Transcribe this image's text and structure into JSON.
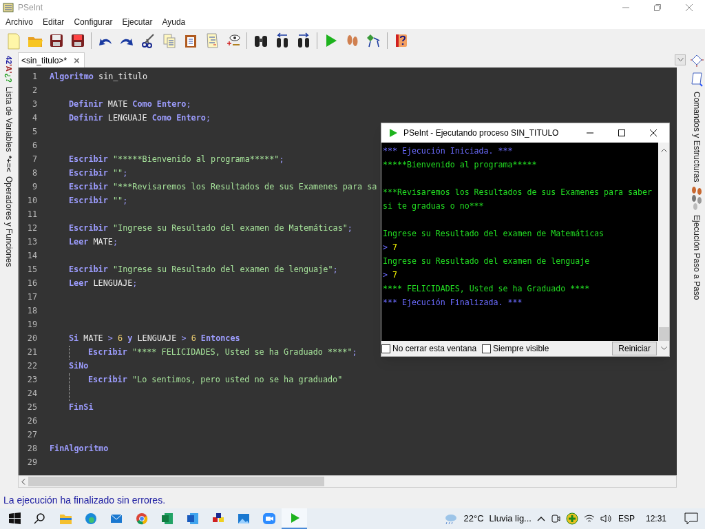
{
  "window": {
    "title": "PSeInt"
  },
  "menu": [
    "Archivo",
    "Editar",
    "Configurar",
    "Ejecutar",
    "Ayuda"
  ],
  "tabs": [
    {
      "label": "<sin_titulo>*",
      "selected": true,
      "close": "×"
    }
  ],
  "left_panel": [
    {
      "icon_texts": [
        "42",
        "'A'",
        "¿?"
      ],
      "label": "Lista de Variables"
    },
    {
      "icon_texts": [
        "*+=<"
      ],
      "label": "Operadores y Funciones"
    }
  ],
  "right_panel": [
    "Comandos y Estructuras",
    "Ejecución Paso a Paso"
  ],
  "code": [
    {
      "n": "1",
      "tokens": [
        {
          "kind": "kw",
          "t": "Algoritmo "
        },
        {
          "kind": "id",
          "t": "sin_titulo"
        }
      ],
      "children": [
        {
          "n": "2"
        },
        {
          "n": "3",
          "tokens": [
            {
              "kind": "kw",
              "t": "Definir "
            },
            {
              "kind": "id",
              "t": "MATE "
            },
            {
              "kind": "kw",
              "t": "Como Entero"
            },
            {
              "kind": "p",
              "t": ";"
            }
          ]
        },
        {
          "n": "4",
          "tokens": [
            {
              "kind": "kw",
              "t": "Definir "
            },
            {
              "kind": "id",
              "t": "LENGUAJE "
            },
            {
              "kind": "kw",
              "t": "Como Entero"
            },
            {
              "kind": "p",
              "t": ";"
            }
          ]
        },
        {
          "n": "5"
        },
        {
          "n": "6"
        },
        {
          "n": "7",
          "tokens": [
            {
              "kind": "kw",
              "t": "Escribir "
            },
            {
              "kind": "str",
              "t": "\"*****Bienvenido al programa*****\""
            },
            {
              "kind": "p",
              "t": ";"
            }
          ]
        },
        {
          "n": "8",
          "tokens": [
            {
              "kind": "kw",
              "t": "Escribir "
            },
            {
              "kind": "str",
              "t": "\"\""
            },
            {
              "kind": "p",
              "t": ";"
            }
          ]
        },
        {
          "n": "9",
          "tokens": [
            {
              "kind": "kw",
              "t": "Escribir "
            },
            {
              "kind": "str",
              "t": "\"***Revisaremos los Resultados de sus Examenes para sa"
            }
          ]
        },
        {
          "n": "10",
          "tokens": [
            {
              "kind": "kw",
              "t": "Escribir "
            },
            {
              "kind": "str",
              "t": "\"\""
            },
            {
              "kind": "p",
              "t": ";"
            }
          ]
        },
        {
          "n": "11"
        },
        {
          "n": "12",
          "tokens": [
            {
              "kind": "kw",
              "t": "Escribir "
            },
            {
              "kind": "str",
              "t": "\"Ingrese su Resultado del examen de Matemáticas\""
            },
            {
              "kind": "p",
              "t": ";"
            }
          ]
        },
        {
          "n": "13",
          "tokens": [
            {
              "kind": "kw",
              "t": "Leer "
            },
            {
              "kind": "id",
              "t": "MATE"
            },
            {
              "kind": "p",
              "t": ";"
            }
          ]
        },
        {
          "n": "14"
        },
        {
          "n": "15",
          "tokens": [
            {
              "kind": "kw",
              "t": "Escribir "
            },
            {
              "kind": "str",
              "t": "\"Ingrese su Resultado del examen de lenguaje\""
            },
            {
              "kind": "p",
              "t": ";"
            }
          ]
        },
        {
          "n": "16",
          "tokens": [
            {
              "kind": "kw",
              "t": "Leer "
            },
            {
              "kind": "id",
              "t": "LENGUAJE"
            },
            {
              "kind": "p",
              "t": ";"
            }
          ]
        },
        {
          "n": "17"
        },
        {
          "n": "18"
        },
        {
          "n": "19"
        },
        {
          "n": "20",
          "tokens": [
            {
              "kind": "kw",
              "t": "Si "
            },
            {
              "kind": "id",
              "t": "MATE "
            },
            {
              "kind": "op",
              "t": "> "
            },
            {
              "kind": "num",
              "t": "6 "
            },
            {
              "kind": "kw",
              "t": "y "
            },
            {
              "kind": "id",
              "t": "LENGUAJE "
            },
            {
              "kind": "op",
              "t": "> "
            },
            {
              "kind": "num",
              "t": "6 "
            },
            {
              "kind": "kw",
              "t": "Entonces"
            }
          ],
          "children": [
            {
              "n": "21",
              "tokens": [
                {
                  "kind": "kw",
                  "t": "Escribir "
                },
                {
                  "kind": "str",
                  "t": "\"**** FELICIDADES, Usted se ha Graduado ****\""
                },
                {
                  "kind": "p",
                  "t": ";"
                }
              ]
            }
          ]
        },
        {
          "n": "22",
          "tokens": [
            {
              "kind": "kw",
              "t": "SiNo"
            }
          ],
          "children": [
            {
              "n": "23",
              "tokens": [
                {
                  "kind": "kw",
                  "t": "Escribir "
                },
                {
                  "kind": "str",
                  "t": "\"Lo sentimos, pero usted no se ha graduado\""
                }
              ]
            },
            {
              "n": "24"
            }
          ]
        },
        {
          "n": "25",
          "tokens": [
            {
              "kind": "kw",
              "t": "FinSi"
            }
          ]
        },
        {
          "n": "26"
        },
        {
          "n": "27"
        }
      ]
    },
    {
      "n": "28",
      "tokens": [
        {
          "kind": "kw",
          "t": "FinAlgoritmo"
        }
      ]
    },
    {
      "n": "29"
    }
  ],
  "console": {
    "title": "PSeInt - Ejecutando proceso SIN_TITULO",
    "lines": [
      {
        "kind": "info",
        "text": "*** Ejecución Iniciada. ***"
      },
      {
        "kind": "output",
        "text": "*****Bienvenido al programa*****"
      },
      {
        "kind": "blank"
      },
      {
        "kind": "output",
        "text": "***Revisaremos los Resultados de sus Examenes para saber si te graduas o no***"
      },
      {
        "kind": "blank"
      },
      {
        "kind": "output",
        "text": "Ingrese su Resultado del examen de Matemáticas"
      },
      {
        "kind": "input",
        "prompt": ">",
        "value": "7"
      },
      {
        "kind": "output",
        "text": "Ingrese su Resultado del examen de lenguaje"
      },
      {
        "kind": "input",
        "prompt": ">",
        "value": "7"
      },
      {
        "kind": "output",
        "text": "**** FELICIDADES, Usted se ha Graduado ****"
      },
      {
        "kind": "info",
        "text": "*** Ejecución Finalizada. ***"
      }
    ],
    "options": [
      {
        "label": "No cerrar esta ventana",
        "checked": false
      },
      {
        "label": "Siempre visible",
        "checked": false
      }
    ],
    "button": "Reiniciar"
  },
  "status_bar": "La ejecución ha finalizado sin errores.",
  "taskbar": {
    "temperature": "22°C",
    "weather": "Lluvia lig...",
    "language": "ESP",
    "time": "12:31"
  }
}
